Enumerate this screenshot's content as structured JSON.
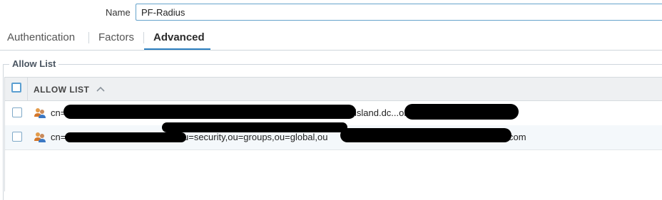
{
  "form": {
    "name_label": "Name",
    "name_value": "PF-Radius"
  },
  "tabs": [
    {
      "label": "Authentication",
      "active": false
    },
    {
      "label": "Factors",
      "active": false
    },
    {
      "label": "Advanced",
      "active": true
    }
  ],
  "section": {
    "title": "Allow List"
  },
  "grid": {
    "column_header": "ALLOW LIST",
    "sort_icon": "chevron-up-icon",
    "rows": [
      {
        "icon": "user-group-icon",
        "text_start": "cn=",
        "text_visible_end": "island.dc...om"
      },
      {
        "icon": "user-group-icon",
        "text_start": "cn=",
        "text_middle": "u=security,ou=groups,ou=global,ou",
        "text_visible_end": "com"
      }
    ]
  },
  "colors": {
    "accent": "#2d7fc0",
    "input_border": "#66a3cc",
    "header_bg": "#eef0f2",
    "row_alt_bg": "#f4f8fb",
    "redaction": "#000000"
  }
}
